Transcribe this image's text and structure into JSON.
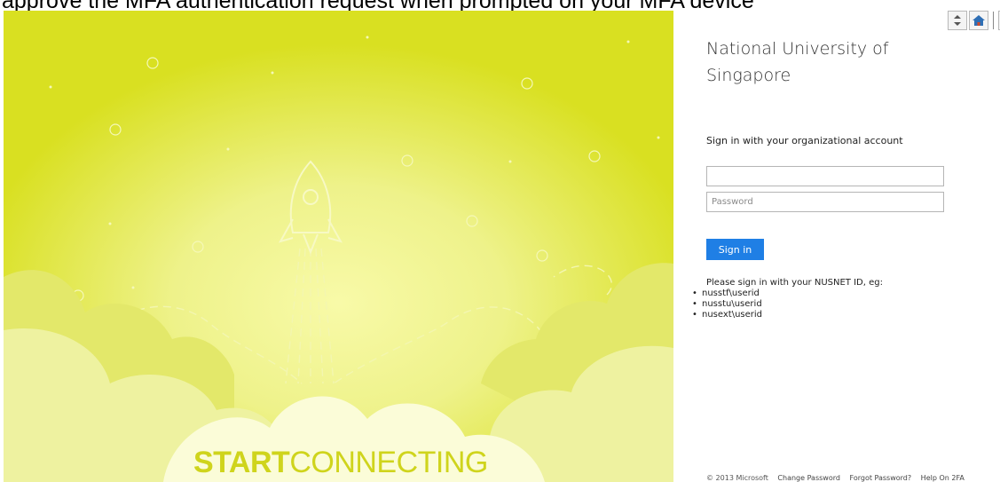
{
  "banner": {
    "text": "approve the MFA authentication request when prompted on your MFA device"
  },
  "illustration": {
    "brand_strong": "START",
    "brand_light": "CONNECTING"
  },
  "login": {
    "organization": "National University of Singapore",
    "heading": "Sign in with your organizational account",
    "username_value": "",
    "password_placeholder": "Password",
    "sign_in_label": "Sign in",
    "hint_intro": "Please sign in with your NUSNET ID, eg:",
    "hint_items": [
      "nusstf\\userid",
      "nusstu\\userid",
      "nusext\\userid"
    ]
  },
  "footer": {
    "copyright": "© 2013 Microsoft",
    "links": [
      "Change Password",
      "Forgot Password?",
      "Help On 2FA"
    ]
  },
  "colors": {
    "illustration_bg": "#d9e021",
    "cloud": "#f3f6b0",
    "accent_button": "#1f7fe5"
  },
  "icons": [
    "arrows-icon",
    "home-icon",
    "bookmark-icon"
  ]
}
